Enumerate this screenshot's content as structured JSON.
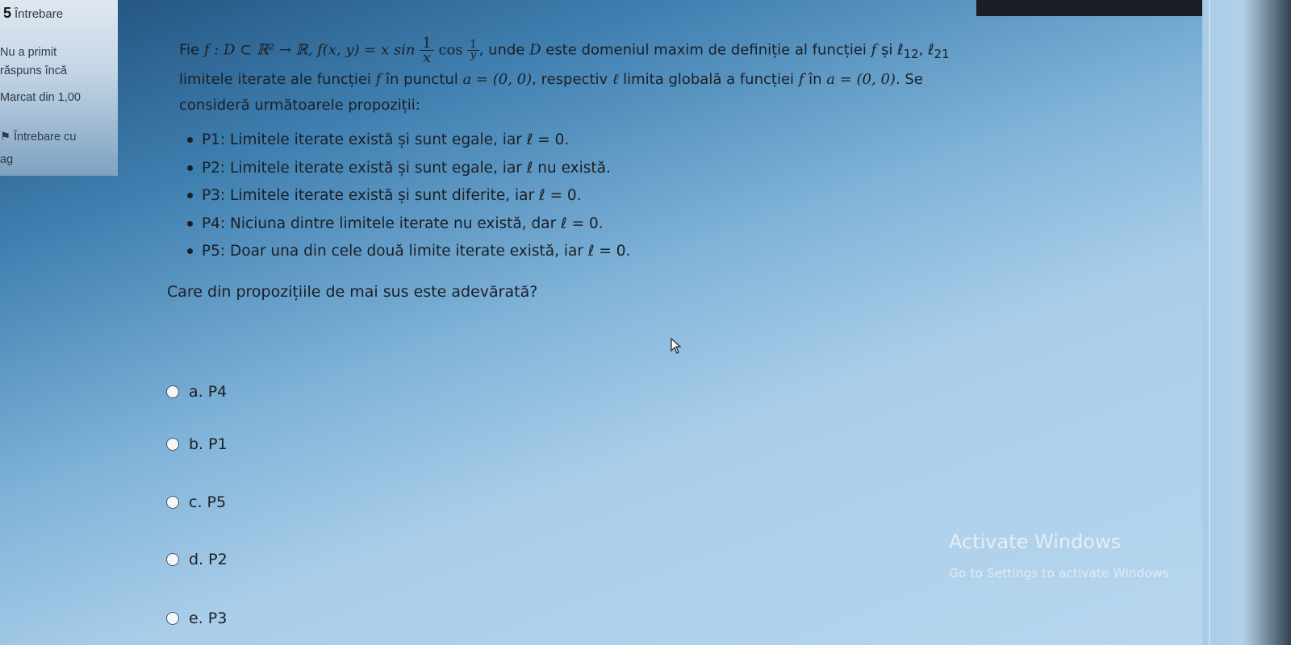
{
  "sidebar": {
    "number": "5",
    "label": "Întrebare",
    "status": "Nu a primit\nrăspuns încă",
    "marks": "Marcat din 1,00",
    "flag": "Întrebare cu\nag"
  },
  "question_intro": {
    "part1": "Fie ",
    "func_def": "f : D ⊂ ℝ² → ℝ, f(x, y) = x sin",
    "frac_num": "1",
    "frac_den": "x",
    "cos_part": "cos",
    "small_frac_num": "1",
    "small_frac_den": "y",
    "part2": ", unde ",
    "D": "D",
    "part3": " este domeniul maxim de definiție al funcției ",
    "f_ref": "f",
    "part4": " și ℓ",
    "sub12": "12",
    "comma": ", ℓ",
    "sub21": "21",
    "line2": "limitele iterate ale funcției ",
    "line2_f": "f",
    "line2_b": " în punctul ",
    "line2_pt": "a = (0, 0)",
    "line2_c": ", respectiv ",
    "line2_l": "ℓ",
    "line2_d": " limita globală a funcției ",
    "line2_f2": "f",
    "line2_e": " în ",
    "line2_pt2": "a = (0, 0)",
    "line2_f3": ". Se",
    "line3": "consideră următoarele propoziții:"
  },
  "propositions": [
    "P1: Limitele iterate există și sunt egale, iar ℓ = 0.",
    "P2: Limitele iterate există și sunt egale, iar ℓ nu există.",
    "P3: Limitele iterate există și sunt diferite, iar ℓ = 0.",
    "P4: Niciuna dintre limitele iterate nu există, dar ℓ = 0.",
    "P5: Doar una din cele două limite iterate există, iar ℓ = 0."
  ],
  "prompt": "Care din propozițiile de mai sus este adevărată?",
  "options": [
    "a. P4",
    "b. P1",
    "c. P5",
    "d. P2",
    "e. P3"
  ],
  "watermark": {
    "title": "Activate Windows",
    "subtitle": "Go to Settings to activate Windows."
  }
}
